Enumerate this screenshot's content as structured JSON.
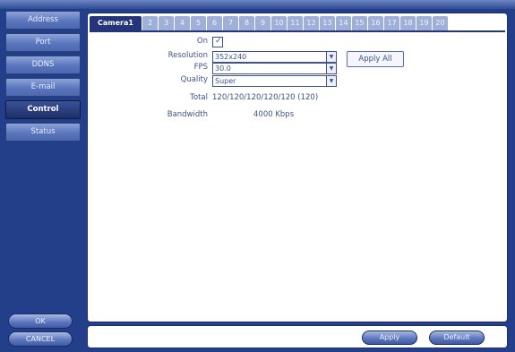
{
  "sidebar": {
    "items": [
      {
        "label": "Address"
      },
      {
        "label": "Port"
      },
      {
        "label": "DDNS"
      },
      {
        "label": "E-mail"
      },
      {
        "label": "Control"
      },
      {
        "label": "Status"
      }
    ],
    "active": "Control",
    "ok_label": "OK",
    "cancel_label": "CANCEL"
  },
  "tabs": {
    "active": "Camera1",
    "items": [
      "2",
      "3",
      "4",
      "5",
      "6",
      "7",
      "8",
      "9",
      "10",
      "11",
      "12",
      "13",
      "14",
      "15",
      "16",
      "17",
      "18",
      "19",
      "20"
    ]
  },
  "form": {
    "on_label": "On",
    "on_checked": true,
    "resolution_label": "Resolution",
    "resolution_value": "352x240",
    "fps_label": "FPS",
    "fps_value": "30.0",
    "quality_label": "Quality",
    "quality_value": "Super",
    "apply_all_label": "Apply All",
    "total_label": "Total",
    "total_value": "120/120/120/120/120 (120)",
    "bandwidth_label": "Bandwidth",
    "bandwidth_value": "4000 Kbps"
  },
  "footer": {
    "apply_label": "Apply",
    "default_label": "Default"
  },
  "icons": {
    "check": "check-icon",
    "dropdown": "dropdown-arrow-icon"
  },
  "colors": {
    "background": "#243f8a",
    "active_tab": "#24357a",
    "text": "#3d5290"
  }
}
